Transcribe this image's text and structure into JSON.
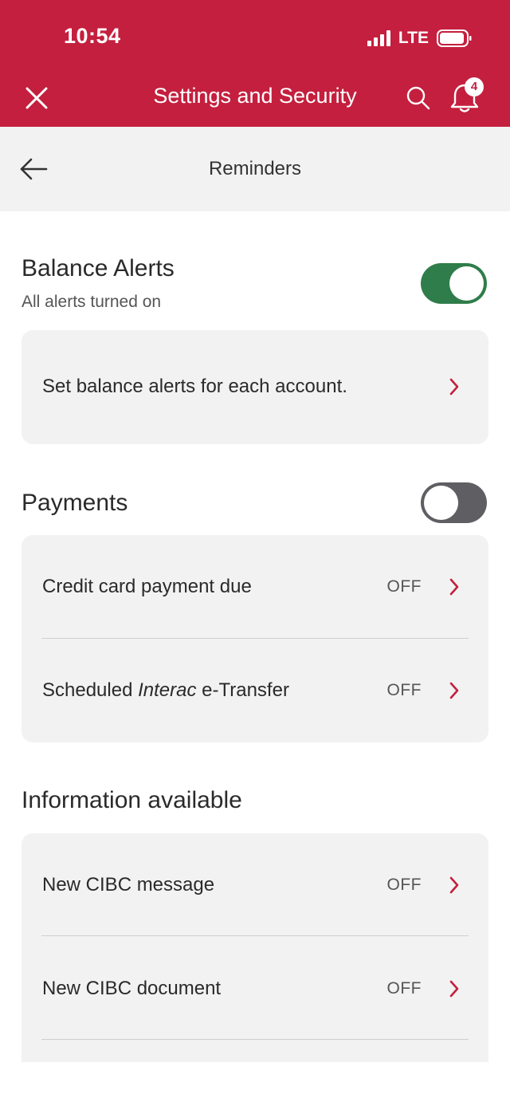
{
  "status_bar": {
    "time": "10:54",
    "network": "LTE"
  },
  "header": {
    "title": "Settings and Security",
    "notification_count": "4"
  },
  "subheader": {
    "title": "Reminders"
  },
  "balance_alerts": {
    "title": "Balance Alerts",
    "subtitle": "All alerts turned on",
    "toggle_on": true,
    "row_label": "Set balance alerts for each account."
  },
  "payments": {
    "title": "Payments",
    "toggle_on": false,
    "rows": [
      {
        "label": "Credit card payment due",
        "value": "OFF"
      },
      {
        "label_before": "Scheduled ",
        "label_italic": "Interac",
        "label_after": " e-Transfer",
        "value": "OFF"
      }
    ]
  },
  "information": {
    "title": "Information available",
    "rows": [
      {
        "label": "New CIBC message",
        "value": "OFF"
      },
      {
        "label": "New CIBC document",
        "value": "OFF"
      }
    ]
  },
  "colors": {
    "brand": "#c41f3e",
    "toggle_on": "#2f7d4a",
    "toggle_off": "#5f5f63",
    "card": "#f2f2f2"
  },
  "icons": [
    "close-icon",
    "search-icon",
    "bell-icon",
    "back-arrow-icon",
    "chevron-right-icon",
    "signal-icon",
    "battery-icon"
  ]
}
